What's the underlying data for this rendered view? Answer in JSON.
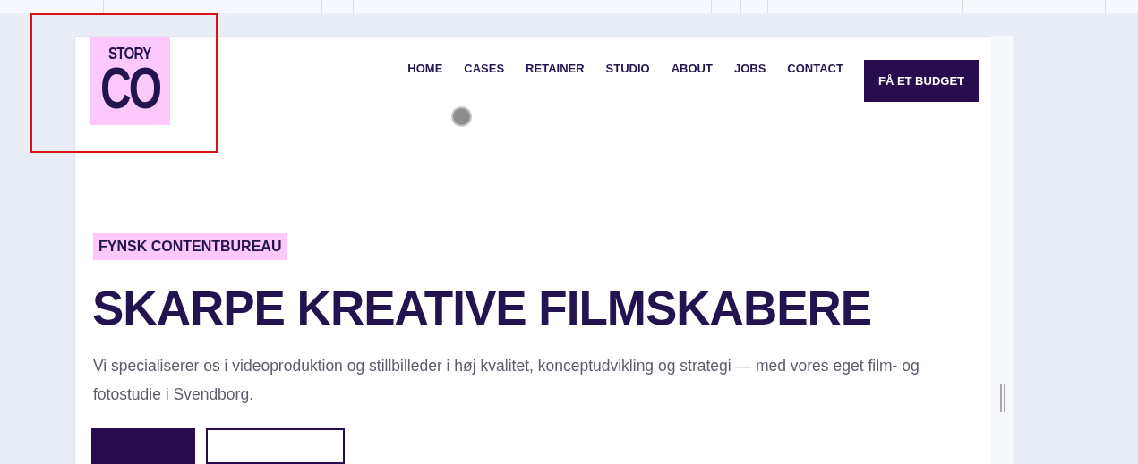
{
  "logo": {
    "top": "STORY",
    "bottom": "CO"
  },
  "nav": {
    "items": [
      {
        "label": "HOME"
      },
      {
        "label": "CASES"
      },
      {
        "label": "RETAINER"
      },
      {
        "label": "STUDIO"
      },
      {
        "label": "ABOUT"
      },
      {
        "label": "JOBS"
      },
      {
        "label": "CONTACT"
      }
    ],
    "cta": "FÅ ET BUDGET"
  },
  "hero": {
    "tag": "FYNSK CONTENTBUREAU",
    "heading": "SKARPE KREATIVE FILMSKABERE",
    "intro": "Vi specialiserer os i videoproduktion og stillbilleder i høj kvalitet, konceptudvikling og strategi — med vores eget film- og fotostudie i Svendborg.",
    "buttons": [
      {
        "kind": "filled"
      },
      {
        "kind": "outline"
      }
    ]
  }
}
